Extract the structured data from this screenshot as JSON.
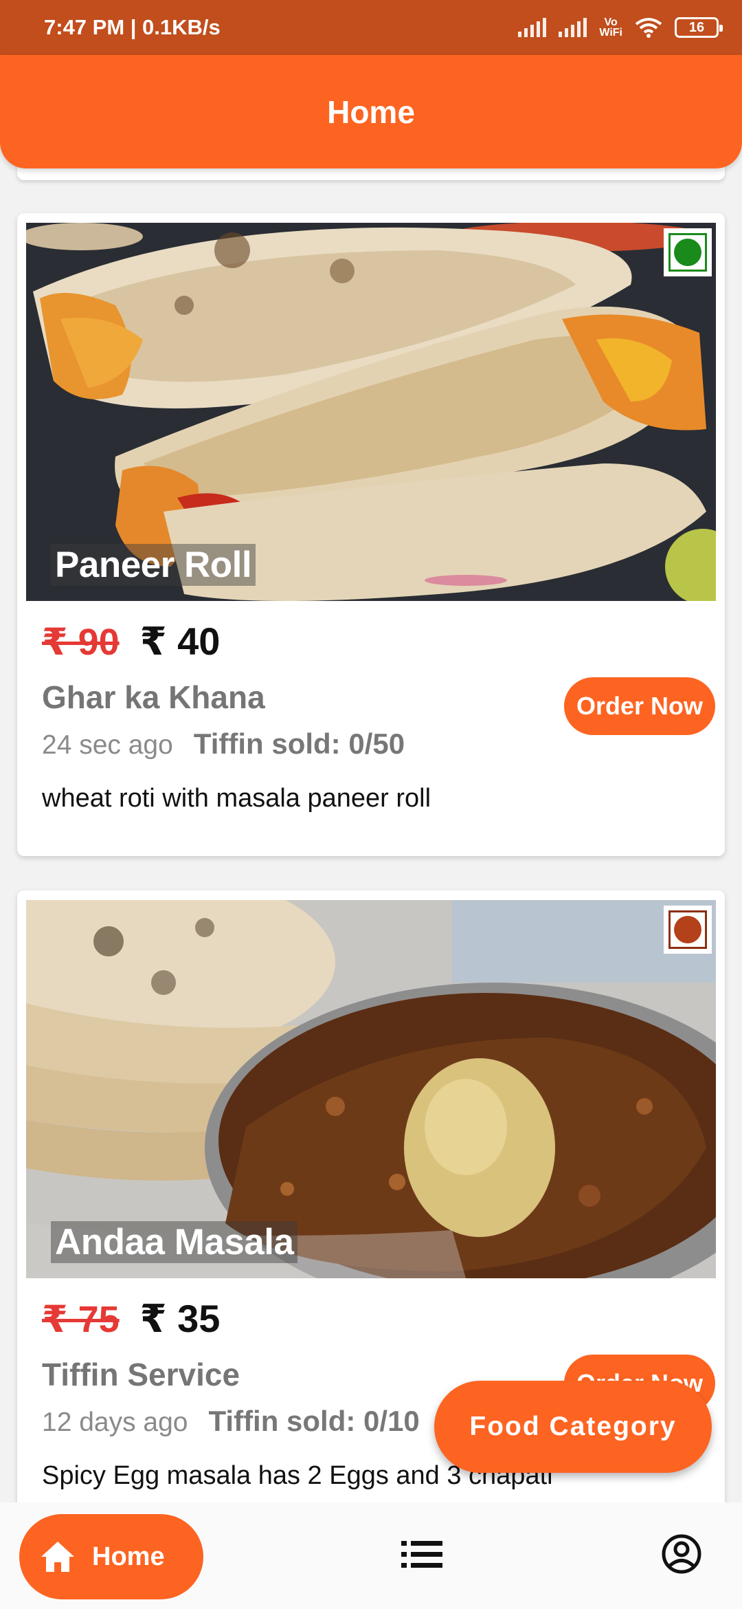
{
  "status_bar": {
    "time_speed": "7:47 PM | 0.1KB/s",
    "vowifi_top": "Vo",
    "vowifi_bottom": "WiFi",
    "battery": "16"
  },
  "app_bar": {
    "title": "Home"
  },
  "cards": [
    {
      "title": "Paneer Roll",
      "old_price": "₹ 90",
      "new_price": "₹ 40",
      "provider": "Ghar ka Khana",
      "time": "24 sec ago",
      "sold": "Tiffin sold: 0/50",
      "description": "wheat roti with masala paneer roll",
      "order_label": "Order Now",
      "type_mark_color": "#1a8a1a"
    },
    {
      "title": "Andaa Masala",
      "old_price": "₹ 75",
      "new_price": "₹ 35",
      "provider": "Tiffin Service",
      "time": "12 days ago",
      "sold": "Tiffin sold: 0/10",
      "description": "Spicy Egg masala has 2 Eggs and 3 chapati",
      "order_label": "Order Now",
      "type_mark_color": "#b3411a"
    }
  ],
  "fab": {
    "label": "Food Category"
  },
  "bottom_nav": {
    "home_label": "Home",
    "icons": [
      "home-icon",
      "list-icon",
      "profile-icon"
    ]
  },
  "colors": {
    "accent": "#fd6422",
    "status_bar": "#c14e1c",
    "price_strike": "#e53935"
  }
}
